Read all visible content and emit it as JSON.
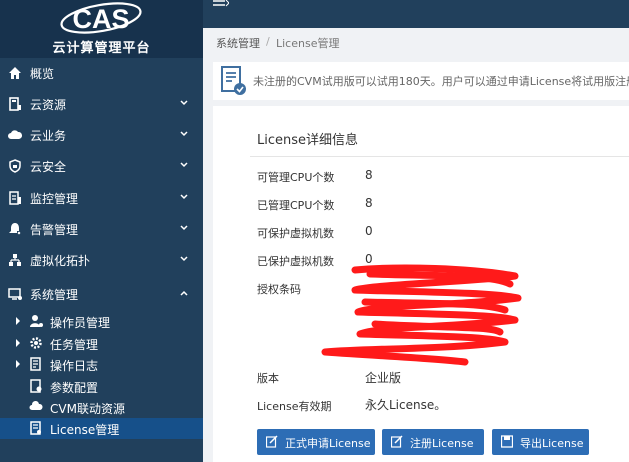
{
  "app": {
    "logo_text": "CAS",
    "subtitle": "云计算管理平台"
  },
  "sidebar": {
    "items": [
      {
        "label": "概览",
        "icon": "home-icon",
        "expandable": false
      },
      {
        "label": "云资源",
        "icon": "server-icon",
        "expandable": true
      },
      {
        "label": "云业务",
        "icon": "cloud-icon",
        "expandable": true
      },
      {
        "label": "云安全",
        "icon": "shield-icon",
        "expandable": true
      },
      {
        "label": "监控管理",
        "icon": "monitor-doc-icon",
        "expandable": true
      },
      {
        "label": "告警管理",
        "icon": "alert-icon",
        "expandable": true
      },
      {
        "label": "虚拟化拓扑",
        "icon": "topology-icon",
        "expandable": true
      },
      {
        "label": "系统管理",
        "icon": "system-icon",
        "expandable": true,
        "expanded": true
      }
    ],
    "subitems": [
      {
        "label": "操作员管理",
        "icon": "user-gear-icon",
        "caret": true
      },
      {
        "label": "任务管理",
        "icon": "gear-icon",
        "caret": true
      },
      {
        "label": "操作日志",
        "icon": "log-icon",
        "caret": true
      },
      {
        "label": "参数配置",
        "icon": "config-icon",
        "caret": false
      },
      {
        "label": "CVM联动资源",
        "icon": "cloud-link-icon",
        "caret": false
      },
      {
        "label": "License管理",
        "icon": "license-icon",
        "caret": false,
        "active": true
      }
    ]
  },
  "breadcrumb": {
    "parent": "系统管理",
    "separator": "/",
    "current": "License管理"
  },
  "notice": {
    "text": "未注册的CVM试用版可以试用180天。用户可以通过申请License将试用版注册为"
  },
  "license": {
    "title": "License详细信息",
    "rows": [
      {
        "label": "可管理CPU个数",
        "value": "8"
      },
      {
        "label": "已管理CPU个数",
        "value": "8"
      },
      {
        "label": "可保护虚拟机数",
        "value": "0"
      },
      {
        "label": "已保护虚拟机数",
        "value": "0"
      },
      {
        "label": "授权条码",
        "value": ""
      },
      {
        "label": "版本",
        "value": "企业版"
      },
      {
        "label": "License有效期",
        "value": "永久License。"
      }
    ]
  },
  "buttons": {
    "apply": "正式申请License",
    "register": "注册License",
    "export": "导出License"
  },
  "colors": {
    "sidebar": "#21405c",
    "active": "#16508a",
    "accent": "#2d6db5",
    "redaction": "#ff1a1a"
  }
}
